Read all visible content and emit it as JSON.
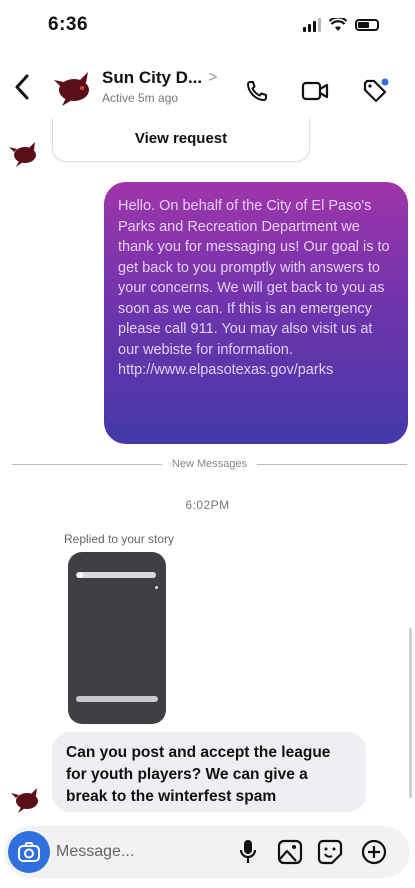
{
  "status": {
    "time": "6:36"
  },
  "header": {
    "title": "Sun City D...",
    "chevron": ">",
    "subtitle": "Active 5m ago"
  },
  "request_card": {
    "label": "View request"
  },
  "outgoing_message": "Hello. On behalf of the City of El Paso's Parks and Recreation Department we thank you for messaging us! Our goal is to get back to you promptly with answers to your concerns. We will get back to you as soon as we can. If this is an emergency please call 911. You may also visit us at our webiste for information. http://www.elpasotexas.gov/parks",
  "divider": {
    "label": "New Messages"
  },
  "timestamp": "6:02PM",
  "story_reply": {
    "label": "Replied to your story"
  },
  "incoming_message": "Can you post and accept the league for youth players? We can give a break to the winterfest spam",
  "composer": {
    "placeholder": "Message..."
  },
  "colors": {
    "accent": "#2f6fe0",
    "bubble_top": "#9b2ba6",
    "bubble_bottom": "#3a2fa4",
    "notify_dot": "#2f6fe0"
  },
  "icons": {
    "back": "chevron-left-icon",
    "call": "phone-icon",
    "video": "video-icon",
    "tag": "tag-icon",
    "camera": "camera-icon",
    "mic": "microphone-icon",
    "gallery": "image-icon",
    "sticker": "sticker-icon",
    "add": "plus-circle-icon"
  }
}
